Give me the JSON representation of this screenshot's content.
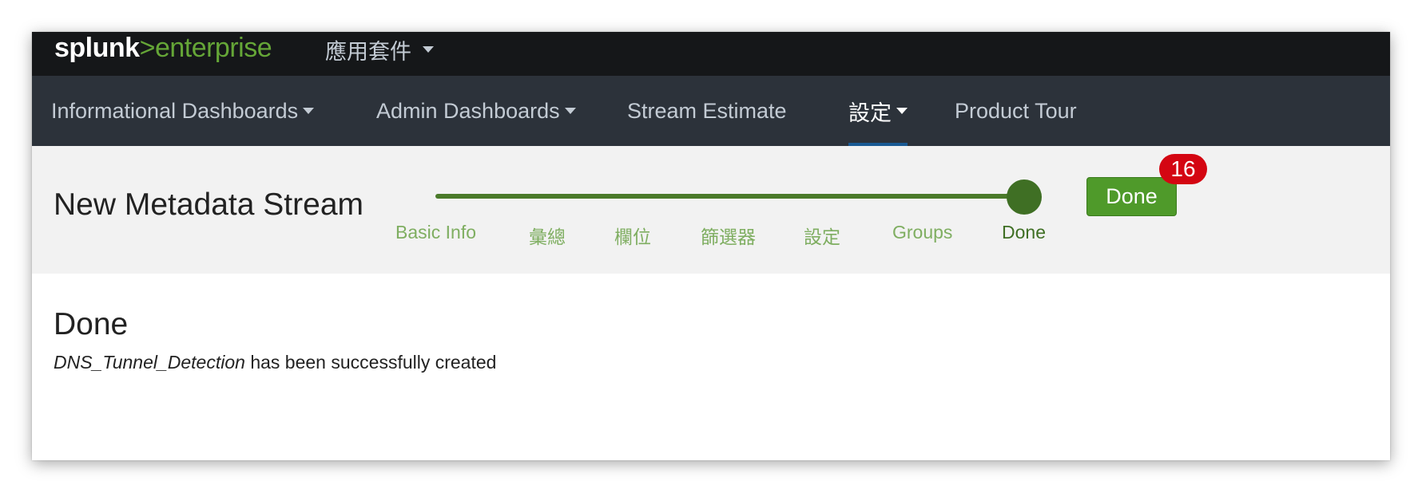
{
  "topbar": {
    "logo_part1": "splunk",
    "logo_part2": ">",
    "logo_part3": "enterprise",
    "apps_label": "應用套件"
  },
  "appnav": {
    "items": [
      {
        "label": "Informational Dashboards",
        "has_caret": true
      },
      {
        "label": "Admin Dashboards",
        "has_caret": true
      },
      {
        "label": "Stream Estimate",
        "has_caret": false
      },
      {
        "label": "設定",
        "has_caret": true,
        "active": true
      },
      {
        "label": "Product Tour",
        "has_caret": false
      }
    ]
  },
  "wizard": {
    "title": "New Metadata Stream",
    "steps": [
      "Basic Info",
      "彙總",
      "欄位",
      "篩選器",
      "設定",
      "Groups",
      "Done"
    ],
    "current_step": "Done",
    "progress": 1.0,
    "done_button": "Done",
    "badge": "16"
  },
  "content": {
    "heading": "Done",
    "stream_name": "DNS_Tunnel_Detection",
    "message": "has been successfully created"
  },
  "colors": {
    "topbar_bg": "#151719",
    "appnav_bg": "#2c323a",
    "accent_green": "#4f9a2a",
    "badge_red": "#d40612"
  }
}
